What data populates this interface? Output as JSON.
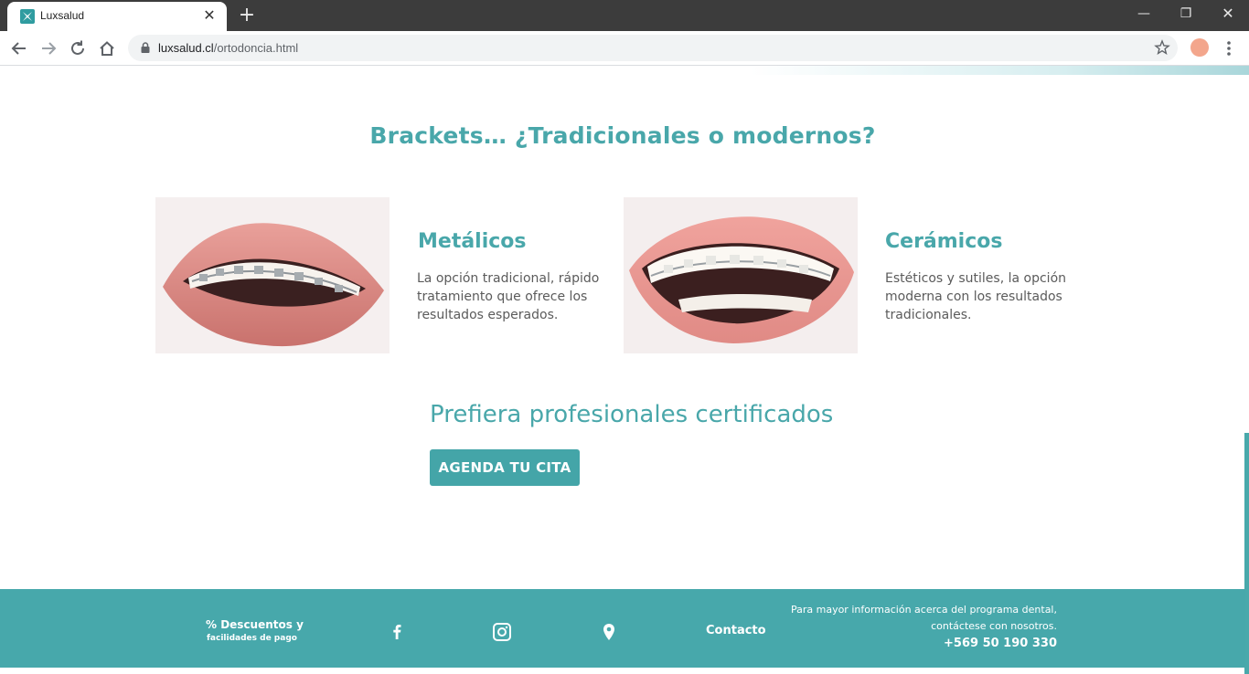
{
  "browser": {
    "tab_title": "Luxsalud",
    "new_tab_symbol": "+",
    "url_domain": "luxsalud.cl",
    "url_path": "/ortodoncia.html"
  },
  "page": {
    "section_title": "Brackets… ¿Tradicionales o modernos?",
    "cards": [
      {
        "title": "Metálicos",
        "text": "La opción tradicional, rápido tratamiento que ofrece los resultados esperados."
      },
      {
        "title": "Cerámicos",
        "text": "Estéticos y sutiles, la opción moderna con los resultados tradicionales."
      }
    ],
    "promo": "Prefiera profesionales certificados",
    "cta_label": "AGENDA TU CITA"
  },
  "footer": {
    "discounts_title": "% Descuentos y",
    "discounts_sub": "facilidades de pago",
    "contact_label": "Contacto",
    "info_text": "Para mayor información acerca del programa dental, contáctese con nosotros.",
    "phone": "+569 50 190 330"
  },
  "colors": {
    "brand_teal": "#47a8ab",
    "chrome_dark": "#3c3c3c",
    "avatar": "#f3a68c"
  },
  "icons": [
    "luxsalud-logo-icon",
    "close-icon",
    "back-arrow-icon",
    "forward-arrow-icon",
    "reload-icon",
    "home-icon",
    "lock-icon",
    "star-icon",
    "kebab-menu-icon",
    "facebook-icon",
    "instagram-icon",
    "location-pin-icon"
  ]
}
